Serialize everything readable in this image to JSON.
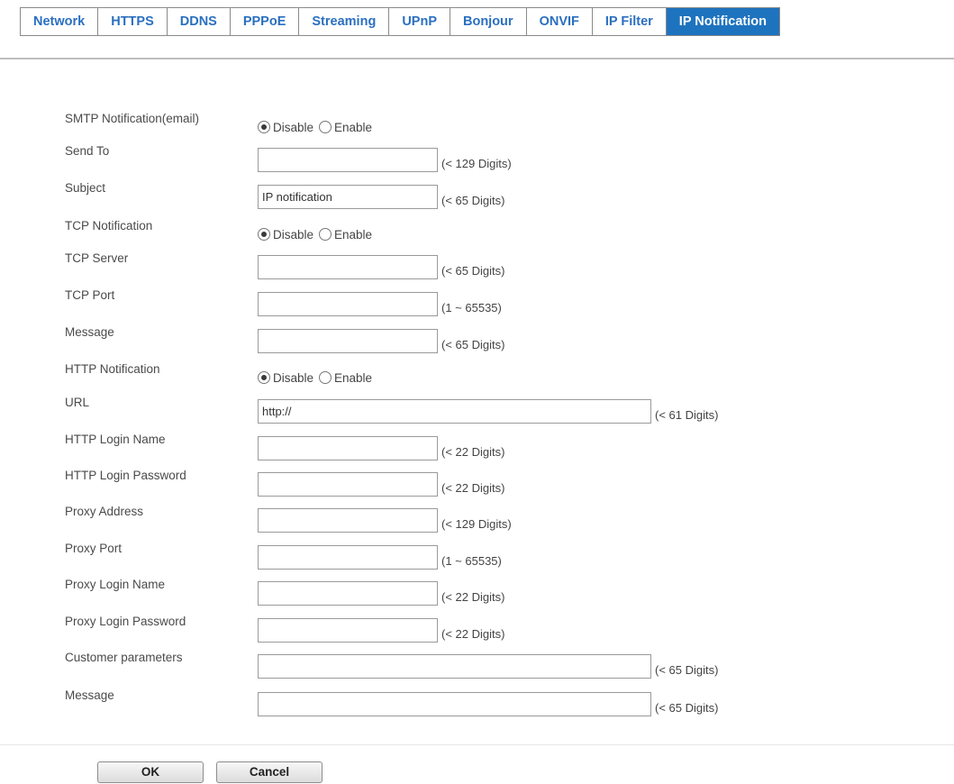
{
  "tabs": [
    {
      "label": "Network",
      "active": false
    },
    {
      "label": "HTTPS",
      "active": false
    },
    {
      "label": "DDNS",
      "active": false
    },
    {
      "label": "PPPoE",
      "active": false
    },
    {
      "label": "Streaming",
      "active": false
    },
    {
      "label": "UPnP",
      "active": false
    },
    {
      "label": "Bonjour",
      "active": false
    },
    {
      "label": "ONVIF",
      "active": false
    },
    {
      "label": "IP Filter",
      "active": false
    },
    {
      "label": "IP Notification",
      "active": true
    }
  ],
  "radio_labels": {
    "disable": "Disable",
    "enable": "Enable"
  },
  "form": {
    "smtp_notification": {
      "label": "SMTP Notification(email)",
      "selected": "Disable"
    },
    "send_to": {
      "label": "Send To",
      "value": "",
      "hint": "(< 129 Digits)"
    },
    "subject": {
      "label": "Subject",
      "value": "IP notification",
      "hint": "(< 65 Digits)"
    },
    "tcp_notification": {
      "label": "TCP Notification",
      "selected": "Disable"
    },
    "tcp_server": {
      "label": "TCP Server",
      "value": "",
      "hint": "(< 65 Digits)"
    },
    "tcp_port": {
      "label": "TCP Port",
      "value": "",
      "hint": "(1 ~ 65535)"
    },
    "tcp_message": {
      "label": "Message",
      "value": "",
      "hint": "(< 65 Digits)"
    },
    "http_notification": {
      "label": "HTTP Notification",
      "selected": "Disable"
    },
    "url": {
      "label": "URL",
      "value": "http://",
      "hint": "(< 61 Digits)"
    },
    "http_login_name": {
      "label": "HTTP Login Name",
      "value": "",
      "hint": "(< 22 Digits)"
    },
    "http_login_password": {
      "label": "HTTP Login Password",
      "value": "",
      "hint": "(< 22 Digits)"
    },
    "proxy_address": {
      "label": "Proxy Address",
      "value": "",
      "hint": "(< 129 Digits)"
    },
    "proxy_port": {
      "label": "Proxy Port",
      "value": "",
      "hint": "(1 ~ 65535)"
    },
    "proxy_login_name": {
      "label": "Proxy Login Name",
      "value": "",
      "hint": "(< 22 Digits)"
    },
    "proxy_login_password": {
      "label": "Proxy Login Password",
      "value": "",
      "hint": "(< 22 Digits)"
    },
    "customer_parameters": {
      "label": "Customer parameters",
      "value": "",
      "hint": "(< 65 Digits)"
    },
    "http_message": {
      "label": "Message",
      "value": "",
      "hint": "(< 65 Digits)"
    }
  },
  "buttons": {
    "ok": "OK",
    "cancel": "Cancel"
  }
}
